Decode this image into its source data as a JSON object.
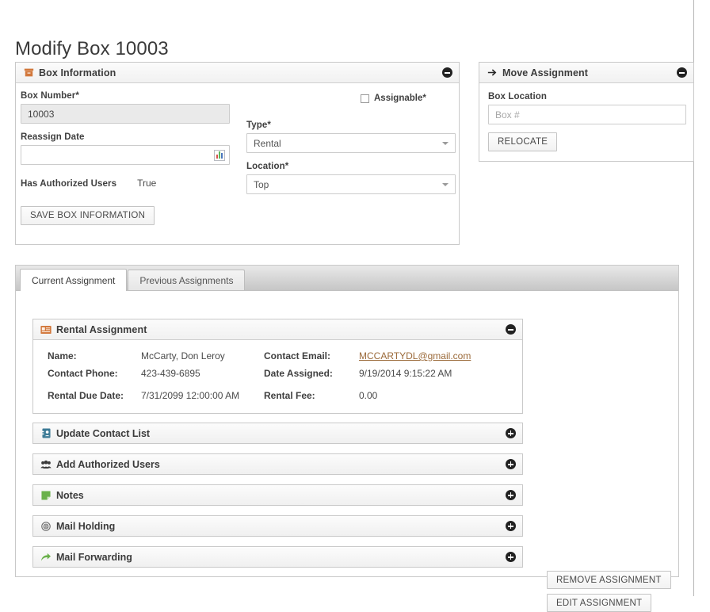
{
  "page": {
    "title": "Modify Box 10003"
  },
  "box_information": {
    "header": "Box Information",
    "icon": "archive-box-icon",
    "toggle_icon": "minus-circle-icon",
    "box_number_label": "Box Number*",
    "box_number_value": "10003",
    "reassign_date_label": "Reassign Date",
    "reassign_date_value": "",
    "reassign_date_picker_icon": "calendar-icon",
    "assignable_label": "Assignable*",
    "assignable_checked": false,
    "type_label": "Type*",
    "type_value": "Rental",
    "location_label": "Location*",
    "location_value": "Top",
    "has_authorized_users_label": "Has Authorized Users",
    "has_authorized_users_value": "True",
    "save_button": "SAVE BOX INFORMATION"
  },
  "move_assignment": {
    "header": "Move Assignment",
    "icon": "arrow-right-icon",
    "toggle_icon": "minus-circle-icon",
    "box_location_label": "Box Location",
    "box_location_value": "",
    "box_location_placeholder": "Box #",
    "relocate_button": "RELOCATE"
  },
  "tabs": [
    {
      "label": "Current Assignment",
      "active": true
    },
    {
      "label": "Previous Assignments",
      "active": false
    }
  ],
  "rental_assignment": {
    "header": "Rental Assignment",
    "icon": "id-card-icon",
    "toggle_icon": "minus-circle-icon",
    "fields": {
      "name_label": "Name:",
      "name_value": "McCarty, Don Leroy",
      "contact_email_label": "Contact Email:",
      "contact_email_value": "MCCARTYDL@gmail.com",
      "contact_phone_label": "Contact Phone:",
      "contact_phone_value": "423-439-6895",
      "date_assigned_label": "Date Assigned:",
      "date_assigned_value": "9/19/2014 9:15:22 AM",
      "rental_due_date_label": "Rental Due Date:",
      "rental_due_date_value": "7/31/2099 12:00:00 AM",
      "rental_fee_label": "Rental Fee:",
      "rental_fee_value": "0.00"
    }
  },
  "side_actions": {
    "remove_assignment": "REMOVE ASSIGNMENT",
    "edit_assignment": "EDIT ASSIGNMENT"
  },
  "accordions": [
    {
      "label": "Update Contact List",
      "icon": "contact-book-icon",
      "toggle_icon": "plus-circle-icon"
    },
    {
      "label": "Add Authorized Users",
      "icon": "users-group-icon",
      "toggle_icon": "plus-circle-icon"
    },
    {
      "label": "Notes",
      "icon": "sticky-note-icon",
      "toggle_icon": "plus-circle-icon"
    },
    {
      "label": "Mail Holding",
      "icon": "pause-circle-icon",
      "toggle_icon": "plus-circle-icon"
    },
    {
      "label": "Mail Forwarding",
      "icon": "share-arrow-icon",
      "toggle_icon": "plus-circle-icon"
    }
  ],
  "colors": {
    "accent_orange": "#d2783c",
    "accent_green": "#6ab14b",
    "accent_blue": "#3d7b96",
    "link": "#9b6a3a",
    "border": "#c9c9c9"
  }
}
